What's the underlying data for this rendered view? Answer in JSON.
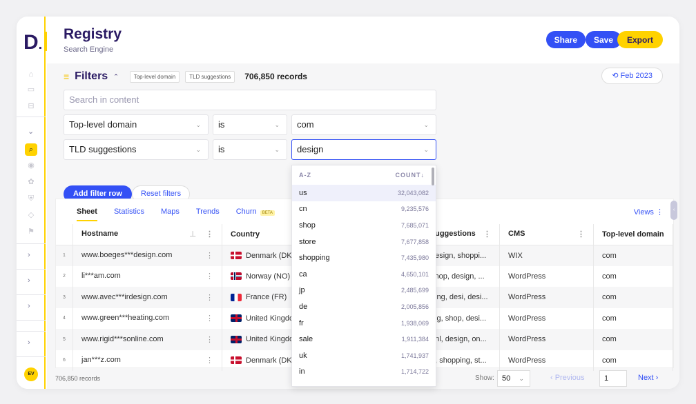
{
  "app": {
    "logo": "D",
    "title": "Registry",
    "subtitle": "Search Engine"
  },
  "header": {
    "share": "Share",
    "save": "Save",
    "export": "Export"
  },
  "sidebar": {
    "avatar": "EV"
  },
  "filters": {
    "label": "Filters",
    "chips": [
      "Top-level domain",
      "TLD suggestions"
    ],
    "records": "706,850 records",
    "date": "Feb 2023",
    "search_placeholder": "Search in content",
    "rows": [
      {
        "field": "Top-level domain",
        "op": "is",
        "value": "com"
      },
      {
        "field": "TLD suggestions",
        "op": "is",
        "value": "design"
      }
    ],
    "add_row": "Add filter row",
    "reset": "Reset filters"
  },
  "dropdown": {
    "sort_az": "A-Z",
    "sort_count": "COUNT↓",
    "items": [
      {
        "label": "us",
        "count": "32,043,082"
      },
      {
        "label": "cn",
        "count": "9,235,576"
      },
      {
        "label": "shop",
        "count": "7,685,071"
      },
      {
        "label": "store",
        "count": "7,677,858"
      },
      {
        "label": "shopping",
        "count": "7,435,980"
      },
      {
        "label": "ca",
        "count": "4,650,101"
      },
      {
        "label": "jp",
        "count": "2,485,699"
      },
      {
        "label": "de",
        "count": "2,005,856"
      },
      {
        "label": "fr",
        "count": "1,938,069"
      },
      {
        "label": "sale",
        "count": "1,911,384"
      },
      {
        "label": "uk",
        "count": "1,741,937"
      },
      {
        "label": "in",
        "count": "1,714,722"
      }
    ]
  },
  "tabs": [
    "Sheet",
    "Statistics",
    "Maps",
    "Trends",
    "Churn"
  ],
  "beta": "BETA",
  "views": "Views",
  "table": {
    "headers": [
      "Hostname",
      "Country",
      "suggestions",
      "CMS",
      "Top-level domain"
    ],
    "rows": [
      {
        "n": "1",
        "host": "www.boeges***design.com",
        "flag": "dk",
        "country": "Denmark (DK)",
        "sugg": "design, shoppi...",
        "cms": "WIX",
        "tld": "com"
      },
      {
        "n": "2",
        "host": "li***am.com",
        "flag": "no",
        "country": "Norway (NO)",
        "sugg": "shop, design, ...",
        "cms": "WordPress",
        "tld": "com"
      },
      {
        "n": "3",
        "host": "www.avec***irdesign.com",
        "flag": "fr",
        "country": "France (FR)",
        "sugg": "ping, desi, desi...",
        "cms": "WordPress",
        "tld": "com"
      },
      {
        "n": "4",
        "host": "www.green***heating.com",
        "flag": "gb",
        "country": "United Kingdom",
        "sugg": "ing, shop, desi...",
        "cms": "WordPress",
        "tld": "com"
      },
      {
        "n": "5",
        "host": "www.rigid***sonline.com",
        "flag": "gb",
        "country": "United Kingdom",
        "sugg": "onl, design, on...",
        "cms": "WordPress",
        "tld": "com"
      },
      {
        "n": "6",
        "host": "jan***z.com",
        "flag": "dk",
        "country": "Denmark (DK)",
        "sugg": "n, shopping, st...",
        "cms": "WordPress",
        "tld": "com"
      }
    ]
  },
  "footer": {
    "records": "706,850 records",
    "show_label": "Show:",
    "page_size": "50",
    "previous": "‹ Previous",
    "page": "1",
    "next": "Next ›"
  }
}
